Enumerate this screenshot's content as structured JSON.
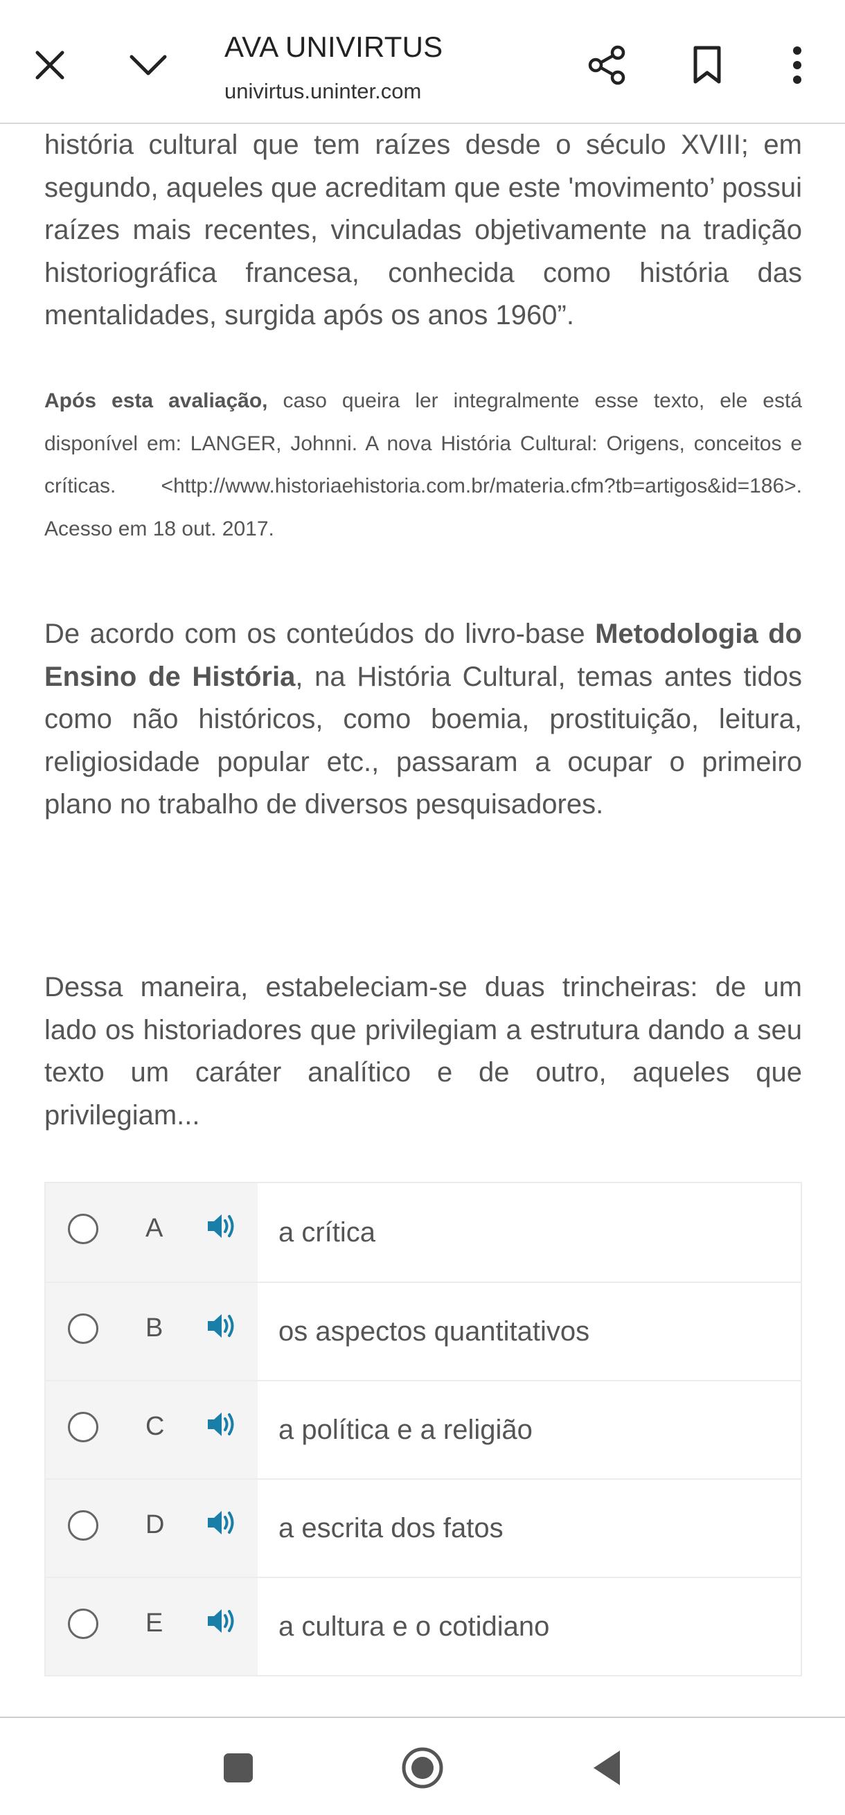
{
  "topbar": {
    "title": "AVA UNIVIRTUS",
    "url": "univirtus.uninter.com",
    "icons": [
      "close-icon",
      "chevron-down-icon",
      "share-icon",
      "bookmark-icon",
      "more-vert-icon"
    ]
  },
  "content": {
    "paragraph1": "história cultural que tem raízes desde o século XVIII; em segundo, aqueles que acreditam que este 'movimento’ possui raízes mais recentes, vinculadas objetivamente na tradição historiográfica francesa, conhecida como história das mentalidades, surgida após os anos 1960”.",
    "note_bold": "Após esta avaliação,",
    "note_text": " caso queira ler integralmente esse texto, ele está disponível em: LANGER, Johnni. A nova História Cultural: Origens, conceitos e críticas. <http://www.historiaehistoria.com.br/materia.cfm?tb=artigos&id=186>. Acesso em 18 out. 2017.",
    "paragraph2_before": "De acordo com os conteúdos do livro-base ",
    "paragraph2_bold": "Metodologia do Ensino de História",
    "paragraph2_after": ", na História Cultural, temas antes tidos como não históricos, como boemia, prostituição, leitura, religiosidade popular etc., passaram a ocupar o primeiro plano no trabalho de diversos pesquisadores.",
    "paragraph3": "Dessa maneira, estabeleciam-se duas trincheiras: de um lado os historiadores que privilegiam a estrutura dando a seu texto um caráter analítico e de outro, aqueles que privilegiam..."
  },
  "options": [
    {
      "letter": "A",
      "text": "a crítica"
    },
    {
      "letter": "B",
      "text": "os aspectos quantitativos"
    },
    {
      "letter": "C",
      "text": "a política e a religião"
    },
    {
      "letter": "D",
      "text": "a escrita dos fatos"
    },
    {
      "letter": "E",
      "text": "a cultura e o cotidiano"
    }
  ],
  "navbar": {
    "icons": [
      "recent-apps-icon",
      "home-icon",
      "back-icon"
    ]
  },
  "colors": {
    "text": "#555555",
    "audio_icon": "#1a7fa8",
    "option_left_bg": "#f4f4f4",
    "border": "#ececec"
  }
}
